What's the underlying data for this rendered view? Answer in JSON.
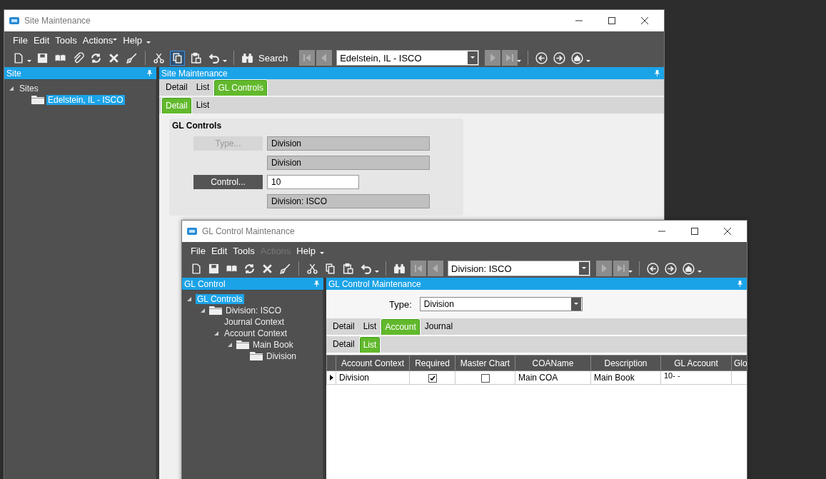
{
  "windows": [
    {
      "kind": "site",
      "title": "Site Maintenance",
      "menu": [
        {
          "label": "File",
          "disabled": false,
          "dropdown": false
        },
        {
          "label": "Edit",
          "disabled": false,
          "dropdown": false
        },
        {
          "label": "Tools",
          "disabled": false,
          "dropdown": false
        },
        {
          "label": "Actions",
          "disabled": false,
          "dropdown": true
        },
        {
          "label": "Help",
          "disabled": false,
          "dropdown": false
        }
      ],
      "toolbar": {
        "search_label": "Search",
        "record": "Edelstein, IL - ISCO"
      },
      "tree_panel": {
        "title": "Site",
        "tree": [
          {
            "label": "Sites",
            "expanded": true,
            "selected": false,
            "children": [
              {
                "label": "Edelstein, IL - ISCO",
                "kind": "folder",
                "selected": true
              }
            ]
          }
        ]
      },
      "main_panel": {
        "title": "Site Maintenance",
        "tabs": [
          {
            "label": "Detail",
            "selected": false
          },
          {
            "label": "List",
            "selected": false
          },
          {
            "label": "GL Controls",
            "selected": true
          }
        ],
        "subtabs": [
          {
            "label": "Detail",
            "selected": true
          },
          {
            "label": "List",
            "selected": false
          }
        ],
        "form": {
          "title": "GL Controls",
          "rows": [
            {
              "button": {
                "label": "Type...",
                "disabled": true
              },
              "value": "Division",
              "editable": false
            },
            {
              "value": "Division",
              "editable": false
            },
            {
              "button": {
                "label": "Control...",
                "disabled": false
              },
              "value": "10",
              "editable": true
            },
            {
              "value": "Division: ISCO",
              "editable": false
            }
          ]
        }
      }
    },
    {
      "kind": "gl",
      "title": "GL Control Maintenance",
      "menu": [
        {
          "label": "File",
          "disabled": false,
          "dropdown": false
        },
        {
          "label": "Edit",
          "disabled": false,
          "dropdown": false
        },
        {
          "label": "Tools",
          "disabled": false,
          "dropdown": false
        },
        {
          "label": "Actions",
          "disabled": true,
          "dropdown": false
        },
        {
          "label": "Help",
          "disabled": false,
          "dropdown": false
        }
      ],
      "toolbar": {
        "record": "Division: ISCO"
      },
      "tree_panel": {
        "title": "GL Control",
        "tree": [
          {
            "label": "GL Controls",
            "expanded": true,
            "selected": true,
            "children": [
              {
                "label": "Division: ISCO",
                "kind": "folder",
                "expanded": true,
                "selected": false,
                "children": [
                  {
                    "label": "Journal Context",
                    "selected": false
                  },
                  {
                    "label": "Account Context",
                    "expanded": true,
                    "selected": false,
                    "children": [
                      {
                        "label": "Main Book",
                        "kind": "folder",
                        "expanded": true,
                        "selected": false,
                        "children": [
                          {
                            "label": "Division",
                            "kind": "folder",
                            "selected": false
                          }
                        ]
                      }
                    ]
                  }
                ]
              }
            ]
          }
        ]
      },
      "main_panel": {
        "title": "GL Control Maintenance",
        "type_field": {
          "label": "Type:",
          "value": "Division"
        },
        "tabs": [
          {
            "label": "Detail",
            "selected": false
          },
          {
            "label": "List",
            "selected": false
          },
          {
            "label": "Account",
            "selected": true
          },
          {
            "label": "Journal",
            "selected": false
          }
        ],
        "subtabs": [
          {
            "label": "Detail",
            "selected": false
          },
          {
            "label": "List",
            "selected": true
          }
        ],
        "table": {
          "columns": [
            "Account Context",
            "Required",
            "Master Chart",
            "COAName",
            "Description",
            "GL Account",
            "Glo"
          ],
          "rows": [
            {
              "selected": true,
              "account_context": "Division",
              "required": true,
              "master_chart": false,
              "coa_name": "Main COA",
              "description": "Main Book",
              "gl_account": "10-   -"
            }
          ]
        }
      }
    }
  ]
}
